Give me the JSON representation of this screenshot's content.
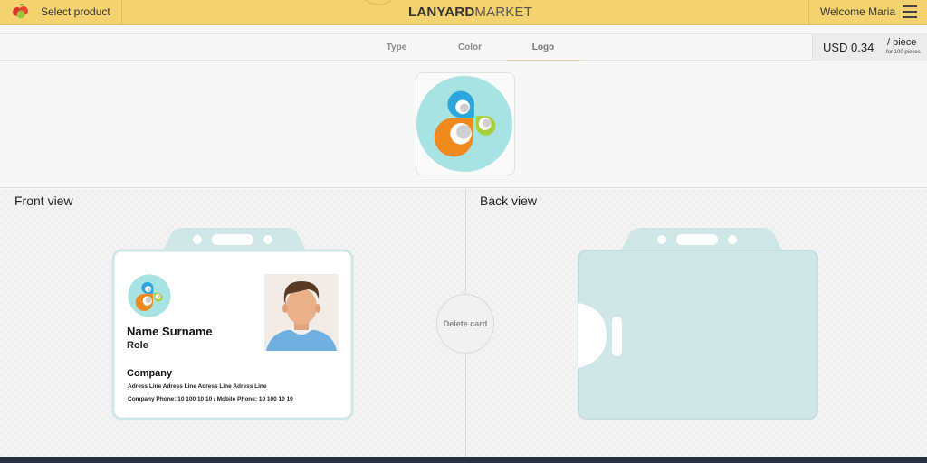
{
  "header": {
    "select_product": "Select product",
    "brand_bold": "LANYARD",
    "brand_light": "MARKET",
    "brand_mark": "®",
    "welcome": "Welcome Maria"
  },
  "tabs": [
    {
      "label": "Type"
    },
    {
      "label": "Color"
    },
    {
      "label": "Logo"
    }
  ],
  "active_tab": "Logo",
  "pricing": {
    "price": "USD 0.34",
    "unit": "/ piece",
    "quantity_note": "for 100 pieces"
  },
  "views": {
    "front_title": "Front view",
    "back_title": "Back view",
    "delete_label": "Delete card"
  },
  "card": {
    "name": "Name Surname",
    "role": "Role",
    "company": "Company",
    "address": "Adress Line Adress Line Adress Line Adress Line",
    "phones": "Company Phone: 10 100 10 10 / Mobile Phone: 10 100 10 10"
  },
  "colors": {
    "header_bg": "#f5d270",
    "holder": "#cfe6e7",
    "logo_bg": "#a8e3e3",
    "logo_blue": "#2ba7dd",
    "logo_orange": "#f08a1f",
    "logo_green": "#a9cf3b",
    "footer": "#27313e"
  },
  "icons": {
    "product": "fruit-icon",
    "menu": "hamburger-menu-icon",
    "logo": "droplets-logo-icon",
    "avatar": "person-photo"
  }
}
